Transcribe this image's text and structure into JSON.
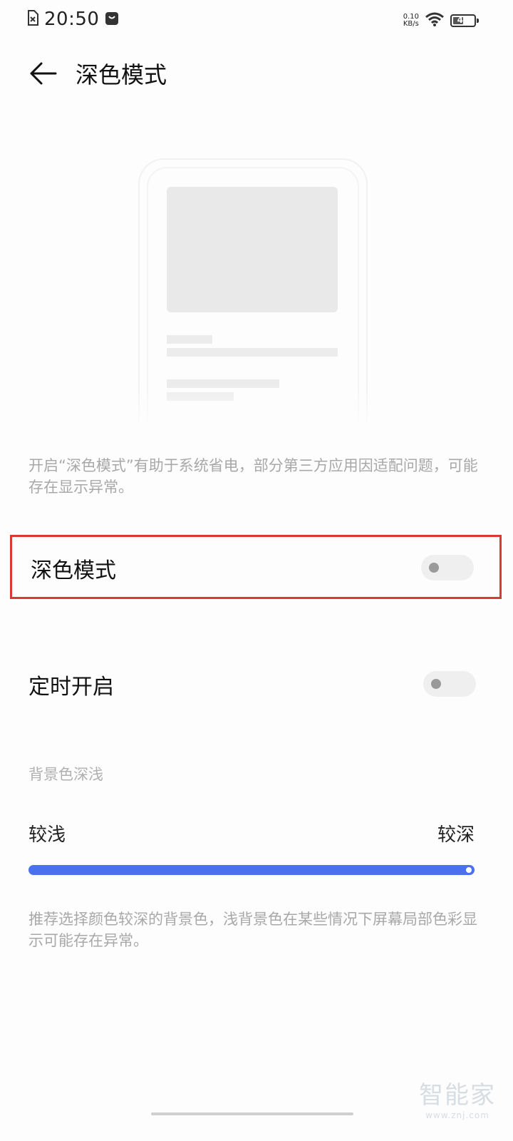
{
  "status_bar": {
    "time": "20:50",
    "net_speed_value": "0.10",
    "net_speed_unit": "KB/s",
    "battery_level": "49",
    "battery_fraction": 0.49,
    "icons": [
      "sim-card-icon",
      "notification-bag-icon",
      "wifi-icon",
      "battery-icon"
    ]
  },
  "header": {
    "title": "深色模式",
    "back_icon": "arrow-left-icon"
  },
  "description": "开启“深色模式”有助于系统省电，部分第三方应用因适配问题，可能存在显示异常。",
  "settings": {
    "dark_mode": {
      "label": "深色模式",
      "enabled": false
    },
    "scheduled": {
      "label": "定时开启",
      "enabled": false
    }
  },
  "background_depth": {
    "section_label": "背景色深浅",
    "min_label": "较浅",
    "max_label": "较深",
    "level": 1.0
  },
  "recommendation": "推荐选择颜色较深的背景色，浅背景色在某些情况下屏幕局部色彩显示可能存在异常。",
  "watermark": {
    "text": "智能家",
    "sub": "www.znj.com"
  },
  "colors": {
    "accent": "#4a6fef",
    "highlight_border": "#d93a36",
    "toggle_off_bg": "#efefef",
    "hint_text": "#a8a8a8"
  }
}
